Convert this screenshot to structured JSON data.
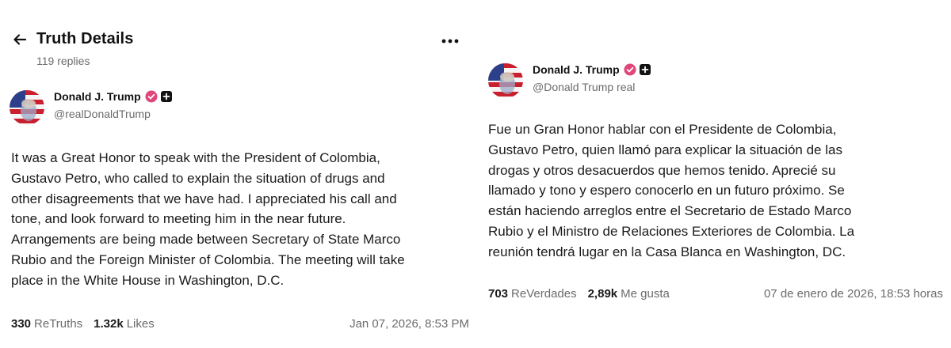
{
  "left": {
    "header": {
      "title": "Truth Details",
      "subtitle": "119 replies"
    },
    "post": {
      "author_name": "Donald J. Trump",
      "handle": "@realDonaldTrump",
      "text_lines": [
        "It was a Great Honor to speak with the President of Colombia,",
        "Gustavo Petro, who called to explain the situation of drugs and",
        "other disagreements that we have had. I appreciated his call and",
        "tone, and look forward to meeting him in the near future.",
        "Arrangements are being made between Secretary of State Marco",
        "Rubio and the Foreign Minister of Colombia. The meeting will take",
        "place in the White House in Washington, D.C."
      ],
      "retruths_count": "330",
      "retruths_label": "ReTruths",
      "likes_count": "1.32k",
      "likes_label": "Likes",
      "timestamp": "Jan 07, 2026, 8:53 PM"
    }
  },
  "right": {
    "post": {
      "author_name": "Donald J. Trump",
      "handle": "@Donald Trump real",
      "text_lines": [
        "Fue un Gran Honor hablar con el Presidente de Colombia,",
        "Gustavo Petro, quien llamó para explicar la situación de las",
        "drogas y otros desacuerdos que hemos tenido. Aprecié su",
        "llamado y tono y espero conocerlo en un futuro próximo. Se",
        "están haciendo arreglos entre el Secretario de Estado Marco",
        "Rubio y el Ministro de Relaciones Exteriores de Colombia. La",
        "reunión tendrá lugar en la Casa Blanca en Washington, DC."
      ],
      "retruths_count": "703",
      "retruths_label": "ReVerdades",
      "likes_count": "2,89k",
      "likes_label": "Me gusta",
      "timestamp": "07 de enero de 2026, 18:53 horas"
    }
  },
  "icons": {
    "back": "arrow-left-icon",
    "more": "more-horizontal-icon",
    "verified": "verified-badge-icon",
    "plus": "plus-badge-icon"
  },
  "colors": {
    "verified": "#e0467a",
    "muted": "#6b6b6b",
    "text": "#1a1a1a"
  }
}
